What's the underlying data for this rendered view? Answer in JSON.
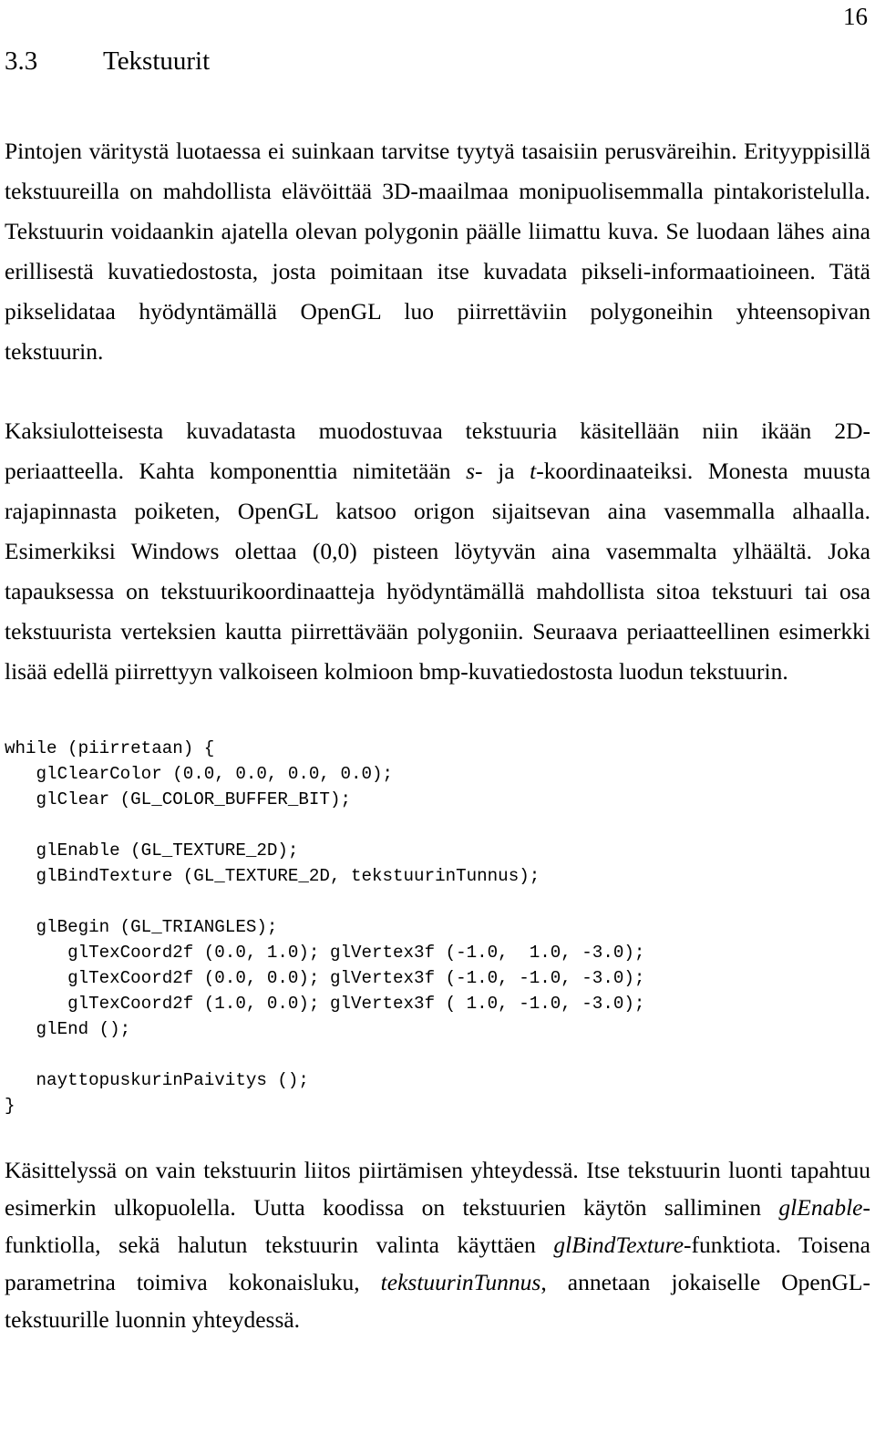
{
  "document": {
    "page_number": "16",
    "heading": {
      "number": "3.3",
      "title": "Tekstuurit"
    },
    "paragraphs": {
      "p1": "Pintojen väritystä luotaessa ei suinkaan tarvitse tyytyä tasaisiin perusväreihin. Erityyppisillä tekstuureilla on mahdollista elävöittää 3D-maailmaa monipuolisemmalla pintakoristelulla. Tekstuurin voidaankin ajatella olevan polygonin päälle liimattu kuva. Se luodaan lähes aina erillisestä kuvatiedostosta, josta poimitaan itse kuvadata pikseli-informaatioineen. Tätä pikselidataa hyödyntämällä OpenGL luo piirrettäviin polygoneihin yhteensopivan tekstuurin.",
      "p2_a": "Kaksiulotteisesta kuvadatasta muodostuvaa tekstuuria käsitellään niin ikään 2D-periaatteella. Kahta komponenttia nimitetään ",
      "p2_italic_s": "s",
      "p2_b": "- ja ",
      "p2_italic_t": "t",
      "p2_c": "-koordinaateiksi. Monesta muusta rajapinnasta poiketen, OpenGL katsoo origon sijaitsevan aina vasemmalla alhaalla. Esimerkiksi Windows olettaa (0,0) pisteen löytyvän aina vasemmalta ylhäältä. Joka tapauksessa on tekstuurikoordinaatteja hyödyntämällä mahdollista sitoa tekstuuri tai osa tekstuurista verteksien kautta piirrettävään polygoniin. Seuraava periaatteellinen esimerkki lisää edellä piirrettyyn valkoiseen kolmioon bmp-kuvatiedostosta luodun tekstuurin.",
      "p3_a": "Käsittelyssä on vain tekstuurin liitos piirtämisen yhteydessä. Itse tekstuurin luonti tapahtuu esimerkin ulkopuolella. Uutta koodissa on tekstuurien käytön salliminen ",
      "p3_italic_1": "glEnable",
      "p3_b": "-funktiolla, sekä halutun tekstuurin valinta käyttäen ",
      "p3_italic_2": "glBindTexture",
      "p3_c": "-funktiota. Toisena parametrina toimiva kokonaisluku, ",
      "p3_italic_3": "tekstuurinTunnus",
      "p3_d": ", annetaan jokaiselle OpenGL-tekstuurille luonnin yhteydessä."
    },
    "code_block": {
      "language": "c",
      "lines": [
        "while (piirretaan) {",
        "   glClearColor (0.0, 0.0, 0.0, 0.0);",
        "   glClear (GL_COLOR_BUFFER_BIT);",
        "",
        "   glEnable (GL_TEXTURE_2D);",
        "   glBindTexture (GL_TEXTURE_2D, tekstuurinTunnus);",
        "",
        "   glBegin (GL_TRIANGLES);",
        "      glTexCoord2f (0.0, 1.0); glVertex3f (-1.0,  1.0, -3.0);",
        "      glTexCoord2f (0.0, 0.0); glVertex3f (-1.0, -1.0, -3.0);",
        "      glTexCoord2f (1.0, 0.0); glVertex3f ( 1.0, -1.0, -3.0);",
        "   glEnd ();",
        "",
        "   nayttopuskurinPaivitys ();",
        "}"
      ]
    },
    "colors": {
      "text": "#000000",
      "background": "#ffffff"
    }
  }
}
